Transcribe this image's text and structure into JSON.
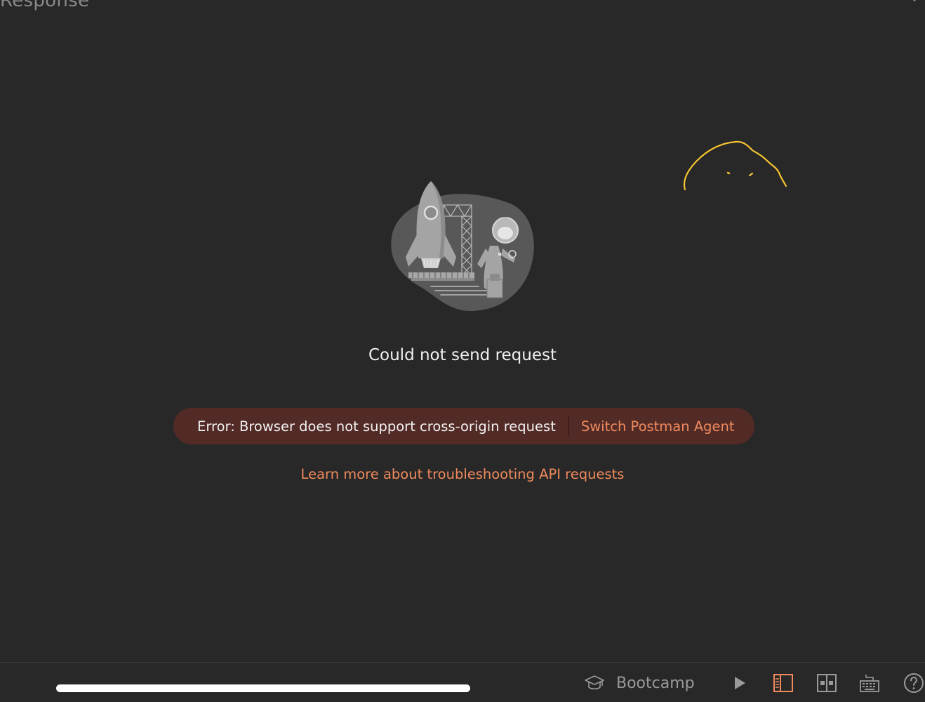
{
  "header": {
    "title": "Response"
  },
  "empty_state": {
    "heading": "Could not send request",
    "error_message": "Error: Browser does not support cross-origin request",
    "switch_agent_label": "Switch Postman Agent",
    "learn_more_label": "Learn more about troubleshooting API requests"
  },
  "status_bar": {
    "bootcamp_label": "Bootcamp",
    "icons": [
      "graduation-cap-icon",
      "runner-play-icon",
      "two-pane-view-icon",
      "layout-toggle-icon",
      "keyboard-shortcuts-icon",
      "help-icon"
    ]
  },
  "colors": {
    "background": "#282828",
    "accent": "#f08a5d",
    "error_pill": "#522a26",
    "annotation_stroke": "#f4c430"
  }
}
